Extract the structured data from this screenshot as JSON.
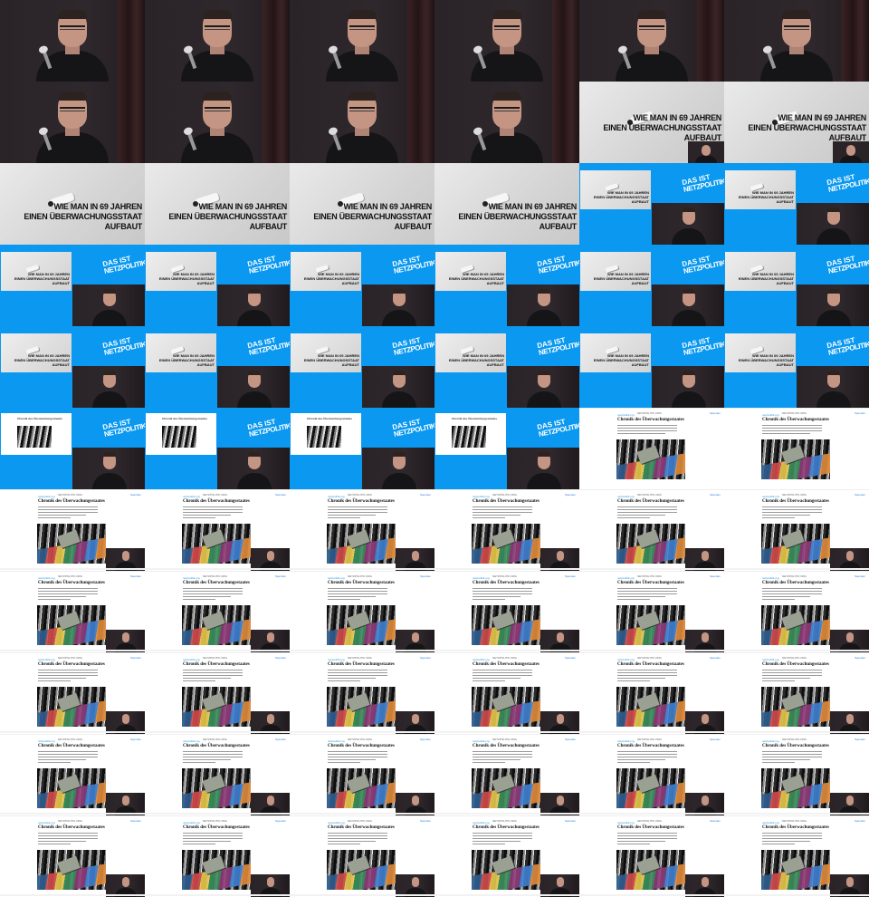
{
  "slide": {
    "title_line1": "WIE MAN IN 69 JAHREN",
    "title_line2": "EINEN ÜBERWACHUNGSSTAAT AUFBAUT"
  },
  "blue": {
    "logo_line1": "DAS IST",
    "logo_line2": "NETZPOLITIK!"
  },
  "article": {
    "title": "Chronik des Überwachungsstaates",
    "kicker": "netzpolitik.org",
    "top_center": "NETZPOLITIK.ORG",
    "top_right": "Spenden"
  },
  "colors": {
    "blue": "#0a98f0",
    "dark_bg": "#2a2428"
  },
  "frames": [
    "speaker",
    "speaker",
    "speaker",
    "speaker",
    "speaker",
    "speaker",
    "speaker",
    "speaker",
    "speaker",
    "speaker",
    "slide-pip",
    "slide-pip",
    "slide",
    "slide",
    "slide",
    "slide",
    "blue",
    "blue",
    "blue",
    "blue",
    "blue",
    "blue",
    "blue",
    "blue",
    "blue",
    "blue",
    "blue",
    "blue",
    "blue",
    "blue",
    "blue-article",
    "blue-article",
    "blue-article",
    "blue-article",
    "article-nopip",
    "article-nopip",
    "article",
    "article",
    "article",
    "article",
    "article",
    "article",
    "article",
    "article",
    "article",
    "article",
    "article",
    "article",
    "article",
    "article",
    "article",
    "article",
    "article",
    "article",
    "article",
    "article",
    "article",
    "article",
    "article",
    "article",
    "article",
    "article",
    "article",
    "article",
    "article",
    "article"
  ]
}
